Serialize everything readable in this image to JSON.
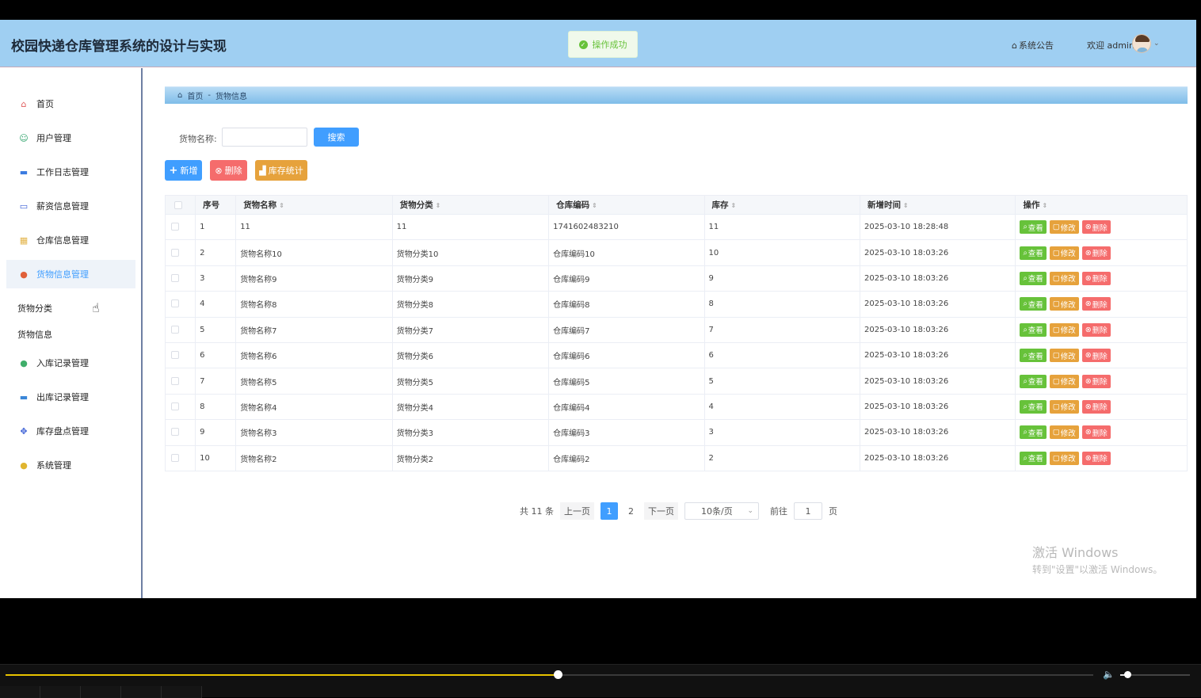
{
  "header": {
    "title": "校园快递仓库管理系统的设计与实现",
    "toast": "操作成功",
    "notice": "系统公告",
    "welcome": "欢迎 admin"
  },
  "sidebar": {
    "items": [
      {
        "label": "首页",
        "icon": "home-icon",
        "color": "#e05a5a"
      },
      {
        "label": "用户管理",
        "icon": "user-icon",
        "color": "#2fa36b"
      },
      {
        "label": "工作日志管理",
        "icon": "bus-icon",
        "color": "#3b7be0"
      },
      {
        "label": "薪资信息管理",
        "icon": "card-icon",
        "color": "#3b5fd6"
      },
      {
        "label": "仓库信息管理",
        "icon": "grid-icon",
        "color": "#e3b44a"
      },
      {
        "label": "货物信息管理",
        "icon": "box-icon",
        "color": "#e0603a"
      },
      {
        "label": "入库记录管理",
        "icon": "circle-icon",
        "color": "#3fae6a"
      },
      {
        "label": "出库记录管理",
        "icon": "list-icon",
        "color": "#3a86d8"
      },
      {
        "label": "库存盘点管理",
        "icon": "apps-icon",
        "color": "#3b5fd6"
      },
      {
        "label": "系统管理",
        "icon": "settings-icon",
        "color": "#e0b52f"
      }
    ],
    "sub_items": [
      "货物分类",
      "货物信息"
    ]
  },
  "breadcrumb": {
    "home": "首页",
    "separator": "-",
    "current": "货物信息"
  },
  "search": {
    "label": "货物名称:",
    "value": "",
    "button": "搜索"
  },
  "actions": {
    "add": "新增",
    "delete": "删除",
    "stats": "库存统计"
  },
  "table": {
    "headers": [
      "序号",
      "货物名称",
      "货物分类",
      "仓库编码",
      "库存",
      "新增时间",
      "操作"
    ],
    "rows": [
      [
        "1",
        "11",
        "11",
        "1741602483210",
        "11",
        "2025-03-10 18:28:48"
      ],
      [
        "2",
        "货物名称10",
        "货物分类10",
        "仓库编码10",
        "10",
        "2025-03-10 18:03:26"
      ],
      [
        "3",
        "货物名称9",
        "货物分类9",
        "仓库编码9",
        "9",
        "2025-03-10 18:03:26"
      ],
      [
        "4",
        "货物名称8",
        "货物分类8",
        "仓库编码8",
        "8",
        "2025-03-10 18:03:26"
      ],
      [
        "5",
        "货物名称7",
        "货物分类7",
        "仓库编码7",
        "7",
        "2025-03-10 18:03:26"
      ],
      [
        "6",
        "货物名称6",
        "货物分类6",
        "仓库编码6",
        "6",
        "2025-03-10 18:03:26"
      ],
      [
        "7",
        "货物名称5",
        "货物分类5",
        "仓库编码5",
        "5",
        "2025-03-10 18:03:26"
      ],
      [
        "8",
        "货物名称4",
        "货物分类4",
        "仓库编码4",
        "4",
        "2025-03-10 18:03:26"
      ],
      [
        "9",
        "货物名称3",
        "货物分类3",
        "仓库编码3",
        "3",
        "2025-03-10 18:03:26"
      ],
      [
        "10",
        "货物名称2",
        "货物分类2",
        "仓库编码2",
        "2",
        "2025-03-10 18:03:26"
      ]
    ],
    "row_actions": {
      "view": "查看",
      "edit": "修改",
      "delete": "删除"
    }
  },
  "pagination": {
    "total": "共 11 条",
    "prev": "上一页",
    "pages": [
      "1",
      "2"
    ],
    "current": "1",
    "next": "下一页",
    "page_size": "10条/页",
    "goto_label": "前往",
    "goto_value": "1",
    "page_suffix": "页"
  },
  "watermark": {
    "line1": "激活 Windows",
    "line2": "转到\"设置\"以激活 Windows。"
  },
  "player": {
    "progress": 0.508,
    "volume": 0.1
  }
}
